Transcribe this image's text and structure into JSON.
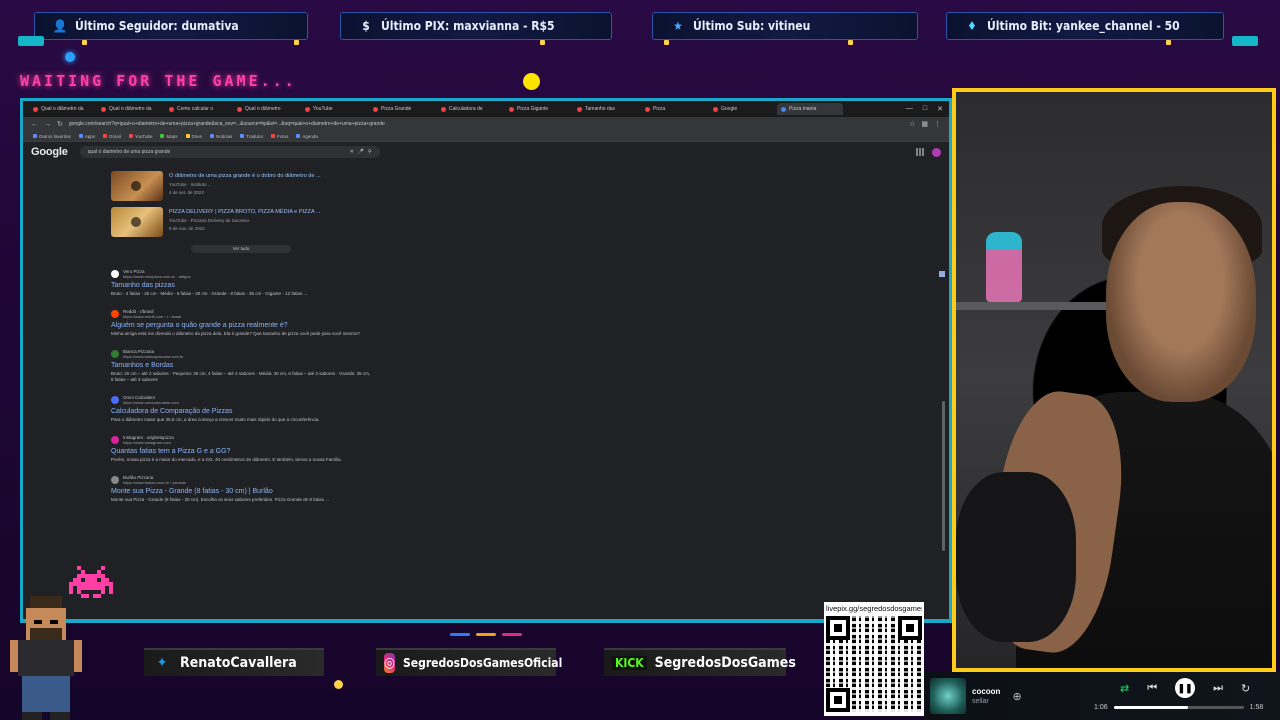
{
  "alerts": [
    {
      "label": "Último Seguidor: dumativa",
      "icon": "user-icon"
    },
    {
      "label": "Último PIX: maxvianna - R$5",
      "icon": "dollar-icon"
    },
    {
      "label": "Último Sub: vitineu",
      "icon": "star-icon"
    },
    {
      "label": "Último Bit: yankee_channel - 50",
      "icon": "diamond-icon"
    }
  ],
  "waiting_text": "WAITING FOR THE GAME...",
  "browser": {
    "tabs": [
      "Qual o diâmetro da",
      "Qual o diâmetro da",
      "Como calcular o",
      "Qual o diâmetro",
      "YouTube",
      "Pizza Grande",
      "Calculadora de",
      "Pizza Gigante",
      "Tamanho das",
      "Pizza",
      "Google",
      "Pizza mania"
    ],
    "url": "google.com/search?q=qual+o+diametro+de+uma+pizza+grande&sca_esv=...&source=hp&ei=...&oq=qual+o+diametro+de+uma+pizza+grande",
    "bookmarks": [
      "Outros favoritos",
      "Apps",
      "Gmail",
      "YouTube",
      "Maps",
      "Drive",
      "Notícias",
      "Tradutor",
      "Fotos",
      "Agenda"
    ],
    "google_logo": "Google",
    "search_query": "qual o diametro de uma pizza grande",
    "videos": [
      {
        "title": "O diâmetro de uma pizza grande é o dobro do diâmetro de ...",
        "meta1": "YouTube · Instituto ...",
        "meta2": "4 de set. de 2023"
      },
      {
        "title": "PIZZA DELIVERY | PIZZA BROTO, PIZZA MÉDIA e PIZZA ...",
        "meta1": "YouTube · Pizzaria Delivery de Sucesso",
        "meta2": "9 de nov. de 2022"
      }
    ],
    "see_all": "Ver tudo",
    "results": [
      {
        "site": "Vero Pizza",
        "url": "https://www.veropizza.com.br · artigos",
        "title": "Tamanho das pizzas",
        "snippet": "Broto - 4 fatias - 25 cm · Média - 6 fatias - 30 cm · Grande - 8 fatias - 35 cm · Gigante - 12 fatias ..."
      },
      {
        "site": "Reddit · r/brasil",
        "url": "https://www.reddit.com › r › brasil",
        "title": "Alguém se pergunta o quão grande a pizza realmente é?",
        "snippet": "Minha amiga está me dizendo o diâmetro da pizza dela. Ela é grande? Que tamanho de pizza você pede para você mesmo?"
      },
      {
        "site": "Bianca Pizzaria",
        "url": "https://www.biancapizzaria.com.br",
        "title": "Tamanhos e Bordas",
        "snippet": "Broto: 20 cm – até 2 sabores · Pequena: 25 cm, 4 fatias – até 2 sabores · Média: 30 cm, 6 fatias – até 3 sabores · Grande: 35 cm, 8 fatias – até 3 sabores"
      },
      {
        "site": "Omni Calculator",
        "url": "https://www.omnicalculator.com",
        "title": "Calculadora de Comparação de Pizzas",
        "snippet": "Para o diâmetro maior que 30,5 cm, a área começa a crescer muito mais rápido do que a circunferência."
      },
      {
        "site": "Instagram · arighetapizza",
        "url": "https://www.instagram.com",
        "title": "Quantas fatias tem a Pizza G e a GG?",
        "snippet": "Porém, nossa pizza é a maior do mercado, e a GG, 40 centímetros de diâmetro. E também, temos a nossa Família."
      },
      {
        "site": "Burlão Pizzaria",
        "url": "https://www.burlao.com.br › produto",
        "title": "Monte sua Pizza - Grande (8 fatias - 30 cm) | Burlão",
        "snippet": "Monte sua Pizza - Grande (8 fatias - 30 cm). Escolha os seus sabores preferidos. Pizza Grande de 8 fatias ..."
      }
    ]
  },
  "socials": [
    {
      "handle": "RenatoCavallera",
      "icon": "twitter-icon"
    },
    {
      "handle": "SegredosDosGamesOficial",
      "icon": "instagram-icon"
    },
    {
      "handle": "SegredosDosGames",
      "icon": "kick-icon",
      "badge": "KICK"
    }
  ],
  "qr": {
    "label": "livepix.gg/segredosdosgames"
  },
  "player": {
    "track": "cocoon",
    "artist": "sellar",
    "elapsed": "1:06",
    "total": "1:58",
    "progress": 0.57
  },
  "colors": {
    "accent_cyan": "#1aa8c8",
    "cam_border": "#ffcc1a",
    "waiting": "#ff3fa6",
    "spotify_green": "#1ed760"
  }
}
